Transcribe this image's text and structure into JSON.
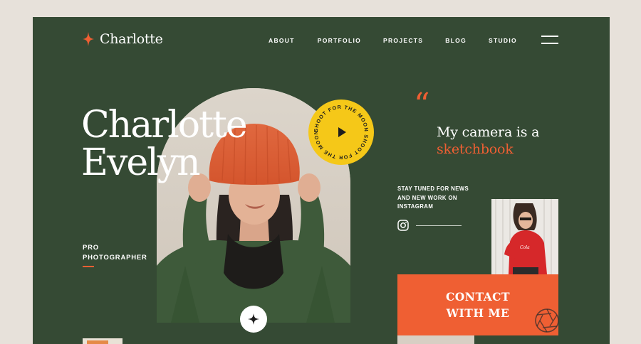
{
  "brand": {
    "name": "Charlotte",
    "accent_color": "#ef5f33",
    "background_color": "#354a34",
    "icon": "sparkle-icon"
  },
  "nav": {
    "items": [
      "ABOUT",
      "PORTFOLIO",
      "PROJECTS",
      "BLOG",
      "STUDIO"
    ],
    "menu_icon": "hamburger-menu-icon"
  },
  "hero": {
    "first_name": "Charlotte",
    "last_name": "Evelyn",
    "role_line1": "PRO",
    "role_line2": "PHOTOGRAPHER"
  },
  "seal": {
    "text": "SHOOT FOR THE MOON SHOOT FOR THE MOON ",
    "color": "#f5c818",
    "icon": "play-icon"
  },
  "quote": {
    "mark": "“",
    "line1": "My camera is a",
    "line2": "sketchbook"
  },
  "instagram": {
    "line1": "STAY TUNED FOR NEWS",
    "line2": "AND NEW WORK ON",
    "line3": "INSTAGRAM",
    "icon": "instagram-icon"
  },
  "contact": {
    "line1": "CONTACT",
    "line2": "WITH ME",
    "icon": "aperture-icon"
  }
}
